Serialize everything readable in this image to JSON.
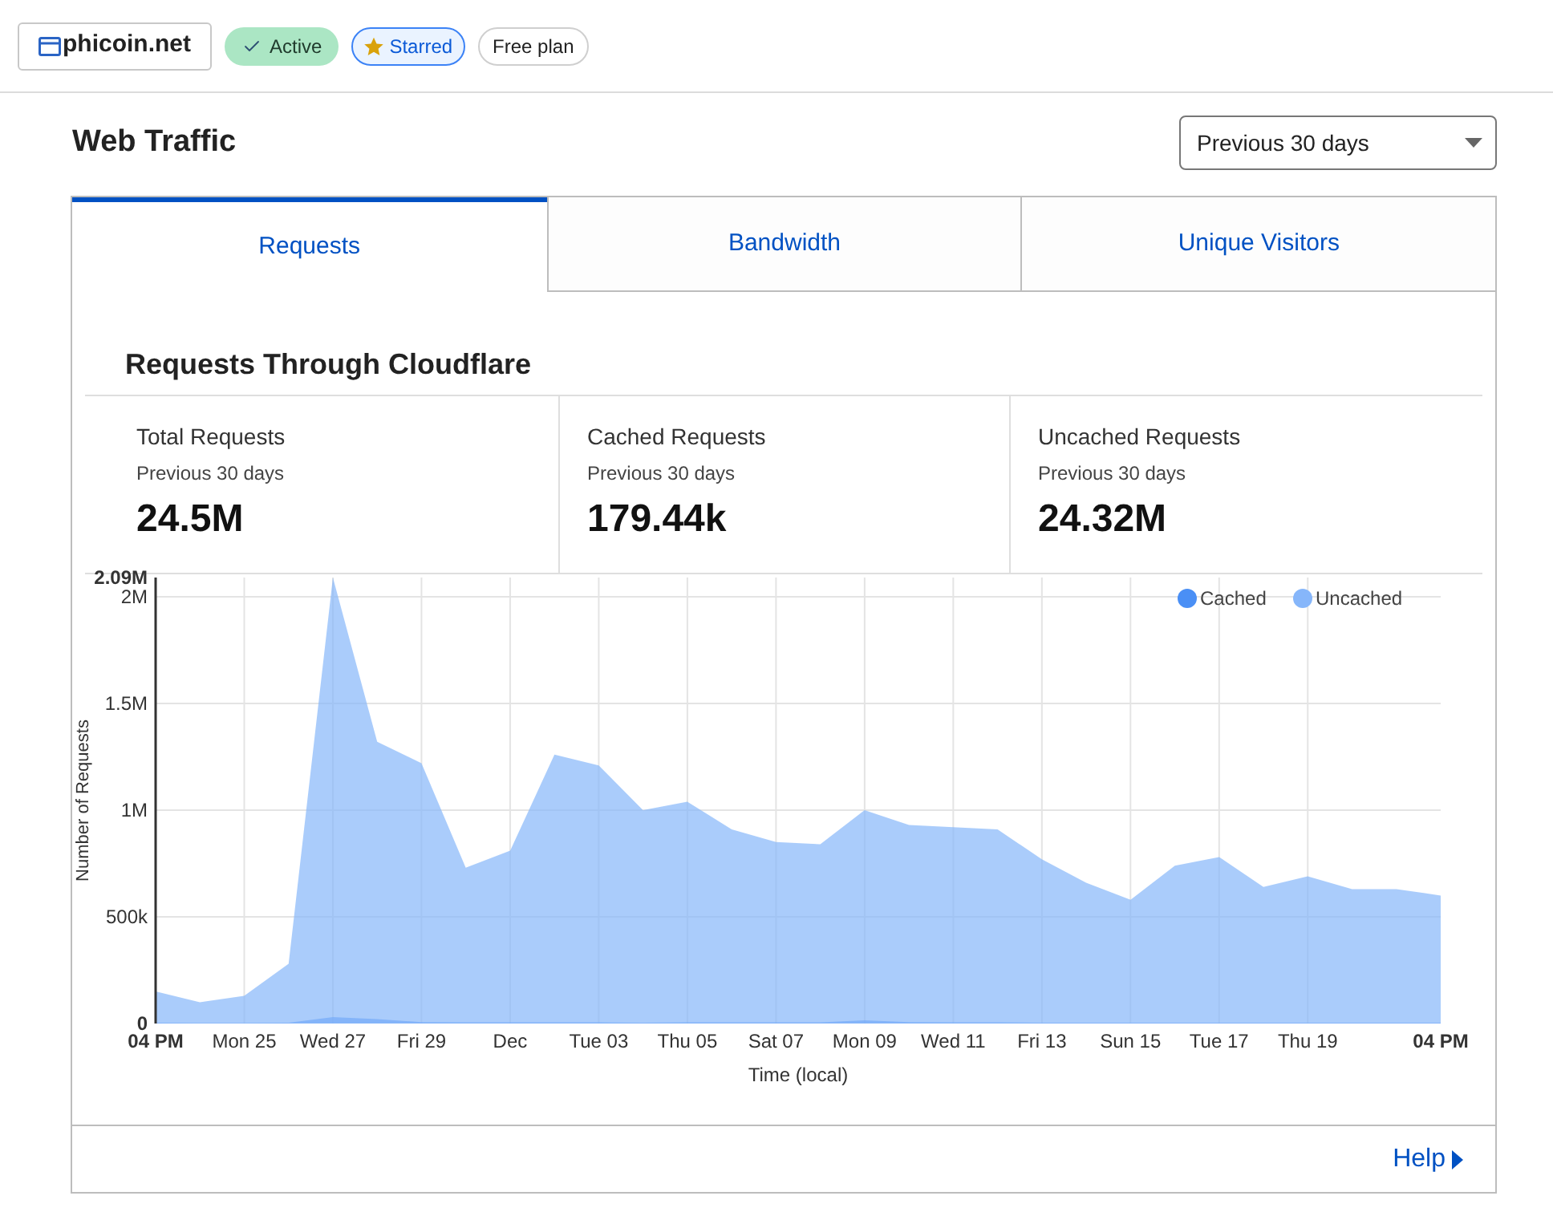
{
  "header": {
    "site": {
      "label": "phicoin.net"
    },
    "badges": [
      {
        "kind": "status",
        "label": "Active"
      },
      {
        "kind": "starred",
        "label": "Starred"
      },
      {
        "kind": "plan",
        "label": "Free plan"
      }
    ]
  },
  "section": {
    "title": "Web Traffic",
    "range_select": {
      "value": "Previous 30 days"
    }
  },
  "tabs": [
    {
      "label": "Requests",
      "selected": true
    },
    {
      "label": "Bandwidth",
      "selected": false
    },
    {
      "label": "Unique Visitors",
      "selected": false
    }
  ],
  "panel": {
    "title": "Requests Through Cloudflare",
    "stats": [
      {
        "label": "Total Requests",
        "period": "Previous 30 days",
        "value": "24.5M"
      },
      {
        "label": "Cached Requests",
        "period": "Previous 30 days",
        "value": "179.44k"
      },
      {
        "label": "Uncached Requests",
        "period": "Previous 30 days",
        "value": "24.32M"
      }
    ],
    "chart_data": {
      "type": "area",
      "xlabel": "Time (local)",
      "ylabel": "Number of Requests",
      "categories": [
        "04 PM",
        null,
        "Mon 25",
        null,
        "Wed 27",
        null,
        "Fri 29",
        null,
        "Dec",
        null,
        "Tue 03",
        null,
        "Thu 05",
        null,
        "Sat 07",
        null,
        "Mon 09",
        null,
        "Wed 11",
        null,
        "Fri 13",
        null,
        "Sun 15",
        null,
        "Tue 17",
        null,
        "Thu 19",
        null,
        null,
        "04 PM"
      ],
      "series": [
        {
          "name": "Cached",
          "color": "#4a8ff5",
          "values": [
            4000,
            3000,
            3000,
            4000,
            30000,
            20000,
            7000,
            5000,
            5000,
            6000,
            5000,
            4000,
            5000,
            6000,
            5000,
            5000,
            15000,
            7000,
            5000,
            5000,
            4000,
            4000,
            4000,
            4000,
            4000,
            4000,
            4000,
            4000,
            4000,
            4000
          ]
        },
        {
          "name": "Uncached",
          "color": "#86b6fa",
          "values": [
            150000,
            100000,
            130000,
            280000,
            2090000,
            1320000,
            1220000,
            730000,
            810000,
            1260000,
            1210000,
            1000000,
            1040000,
            910000,
            850000,
            840000,
            1000000,
            930000,
            920000,
            910000,
            770000,
            660000,
            580000,
            740000,
            780000,
            640000,
            690000,
            630000,
            630000,
            600000
          ]
        }
      ],
      "ylim": [
        0,
        2090000
      ],
      "yticks": [
        0,
        {
          "value": 500000,
          "label": "500k"
        },
        {
          "value": 1000000,
          "label": "1M"
        },
        {
          "value": 1500000,
          "label": "1.5M"
        },
        {
          "value": 2000000,
          "label": "2M"
        },
        {
          "value": 2090000,
          "label": "2.09M"
        }
      ],
      "stacked": false,
      "grid": true,
      "legend": "upper right"
    },
    "help_link": {
      "label": "Help"
    }
  }
}
